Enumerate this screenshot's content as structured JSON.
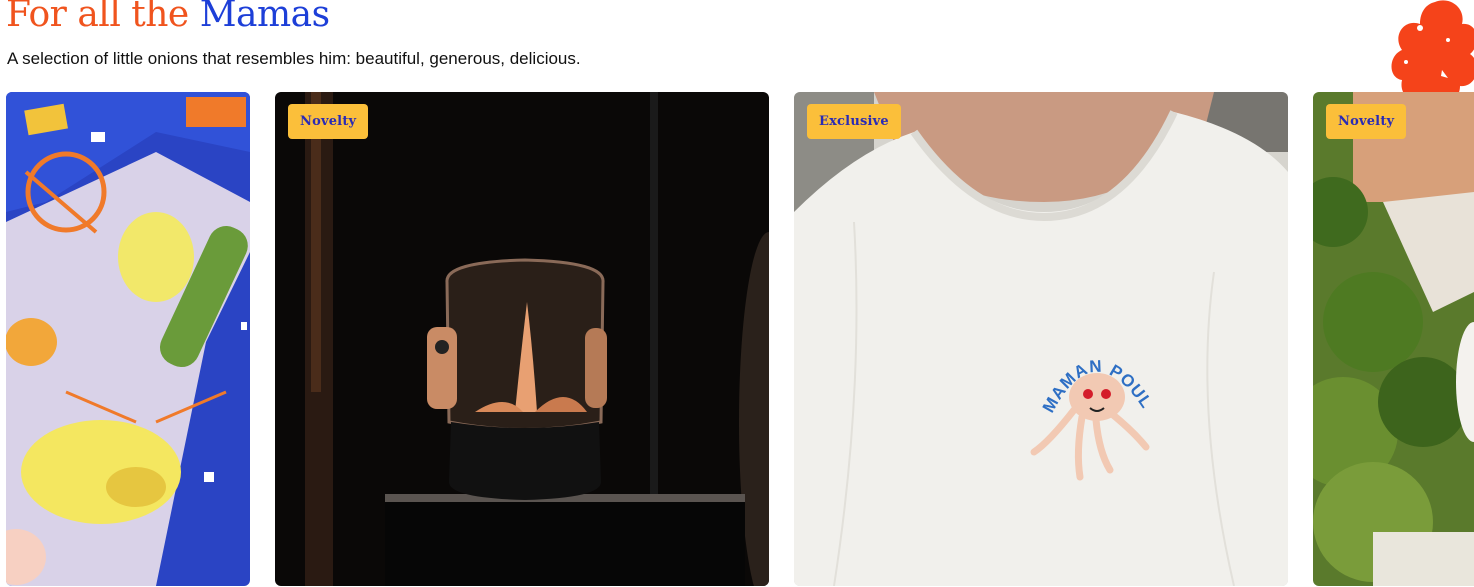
{
  "section": {
    "title_part1": "For all the",
    "title_part2": "Mamas",
    "subtitle": "A selection of little onions that resembles him: beautiful, generous, delicious."
  },
  "colors": {
    "title_orange": "#f0541e",
    "title_blue": "#1d3fd8",
    "badge_bg": "#fbbf3a",
    "badge_text": "#2a2bb5"
  },
  "products": [
    {
      "name": "puzzle",
      "badge": ""
    },
    {
      "name": "fire-lantern",
      "badge": "Novelty"
    },
    {
      "name": "maman-poulpe-tshirt",
      "badge": "Exclusive",
      "print_text": "MAMAN POULPE"
    },
    {
      "name": "garden-vase",
      "badge": "Novelty"
    }
  ]
}
